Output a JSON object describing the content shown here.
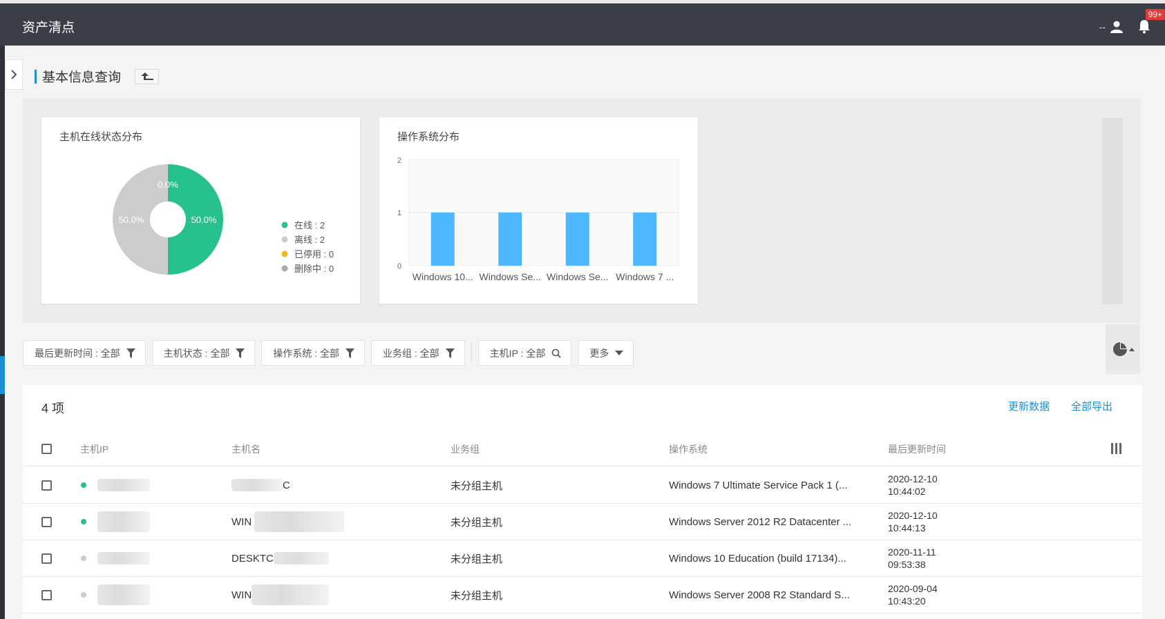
{
  "app": {
    "title": "资产清点"
  },
  "header": {
    "user_label": "--",
    "notification_badge": "99+"
  },
  "page": {
    "title": "基本信息查询"
  },
  "charts": {
    "online_status": {
      "title": "主机在线状态分布",
      "slice_labels": [
        "50.0%",
        "50.0%",
        "0.0%"
      ],
      "legend": [
        "在线 : 2",
        "离线 : 2",
        "已停用 : 0",
        "删除中 : 0"
      ]
    },
    "os_dist": {
      "title": "操作系统分布"
    }
  },
  "chart_data": [
    {
      "type": "pie",
      "labels": [
        "在线",
        "离线",
        "已停用",
        "删除中"
      ],
      "values": [
        2,
        2,
        0,
        0
      ],
      "colors": [
        "#26c18d",
        "#cccccc",
        "#f5b51e",
        "#aaaaaa"
      ],
      "donut": true,
      "legend_position": "right"
    },
    {
      "type": "bar",
      "categories": [
        "Windows 10...",
        "Windows Se...",
        "Windows Se...",
        "Windows 7 ..."
      ],
      "values": [
        1,
        1,
        1,
        1
      ],
      "yticks": [
        "0",
        "1",
        "2"
      ],
      "ylim": [
        0,
        2
      ],
      "color": "#4db8ff",
      "grid": true
    }
  ],
  "filters": [
    {
      "label": "最后更新时间 : 全部",
      "icon": "filter-icon"
    },
    {
      "label": "主机状态 : 全部",
      "icon": "filter-icon"
    },
    {
      "label": "操作系统 : 全部",
      "icon": "filter-icon"
    },
    {
      "label": "业务组 : 全部",
      "icon": "filter-icon"
    },
    {
      "label": "主机IP : 全部",
      "icon": "search-icon"
    },
    {
      "label": "更多",
      "icon": "caret-down-icon"
    }
  ],
  "table": {
    "count_label": "4 项",
    "actions": {
      "refresh": "更新数据",
      "export": "全部导出"
    },
    "columns": [
      "主机IP",
      "主机名",
      "业务组",
      "操作系统",
      "最后更新时间"
    ],
    "rows": [
      {
        "status": "online",
        "status_color": "#26c18d",
        "hostname_visible": "C",
        "group": "未分组主机",
        "os": "Windows 7 Ultimate Service Pack 1 (...",
        "updated_date": "2020-12-10",
        "updated_time": "10:44:02"
      },
      {
        "status": "online",
        "status_color": "#26c18d",
        "hostname_visible": "WIN",
        "group": "未分组主机",
        "os": "Windows Server 2012 R2 Datacenter ...",
        "updated_date": "2020-12-10",
        "updated_time": "10:44:13"
      },
      {
        "status": "offline",
        "status_color": "#cccccc",
        "hostname_visible": "DESKTC",
        "group": "未分组主机",
        "os": "Windows 10 Education (build 17134)...",
        "updated_date": "2020-11-11",
        "updated_time": "09:53:38"
      },
      {
        "status": "offline",
        "status_color": "#cccccc",
        "hostname_visible": "WIN",
        "group": "未分组主机",
        "os": "Windows Server 2008 R2 Standard S...",
        "updated_date": "2020-09-04",
        "updated_time": "10:43:20"
      }
    ]
  }
}
